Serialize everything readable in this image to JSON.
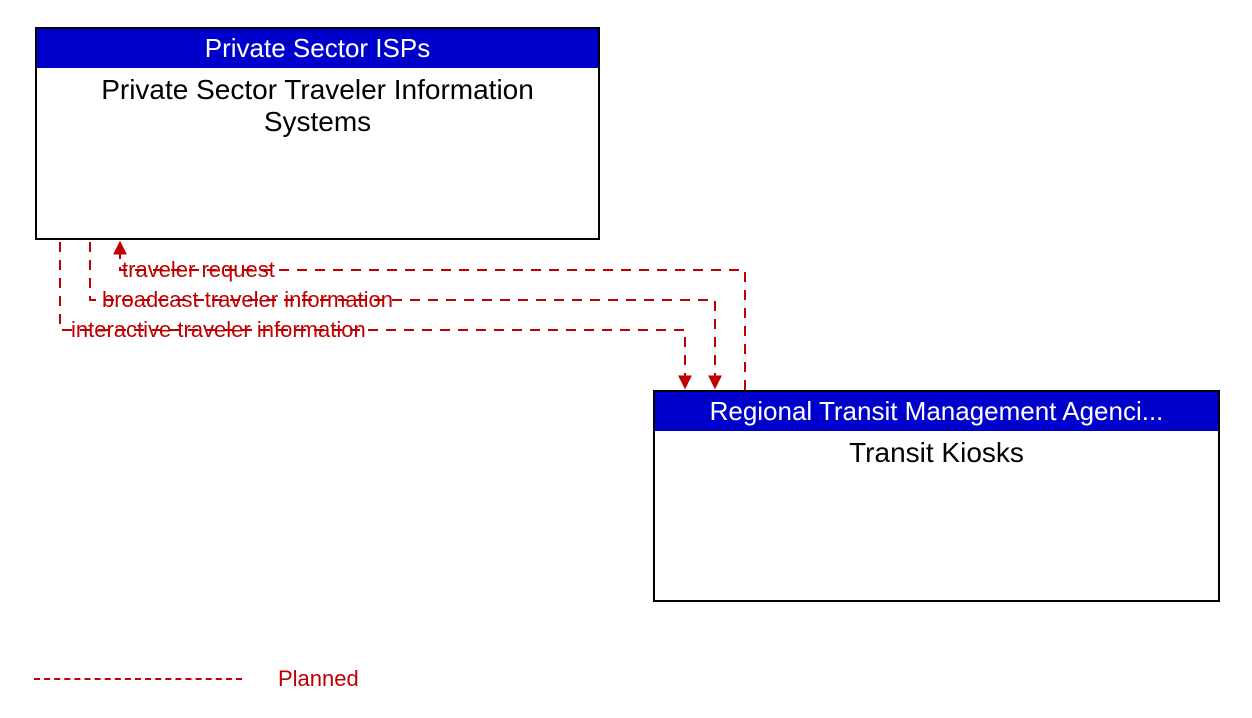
{
  "entities": {
    "left": {
      "header": "Private Sector ISPs",
      "body": "Private Sector Traveler Information Systems"
    },
    "right": {
      "header": "Regional Transit Management Agenci...",
      "body": "Transit Kiosks"
    }
  },
  "flows": {
    "traveler_request": "traveler request",
    "broadcast": "broadcast traveler information",
    "interactive": "interactive traveler information"
  },
  "legend": {
    "planned": "Planned"
  },
  "colors": {
    "header_bg": "#0000cd",
    "flow": "#c00000"
  }
}
